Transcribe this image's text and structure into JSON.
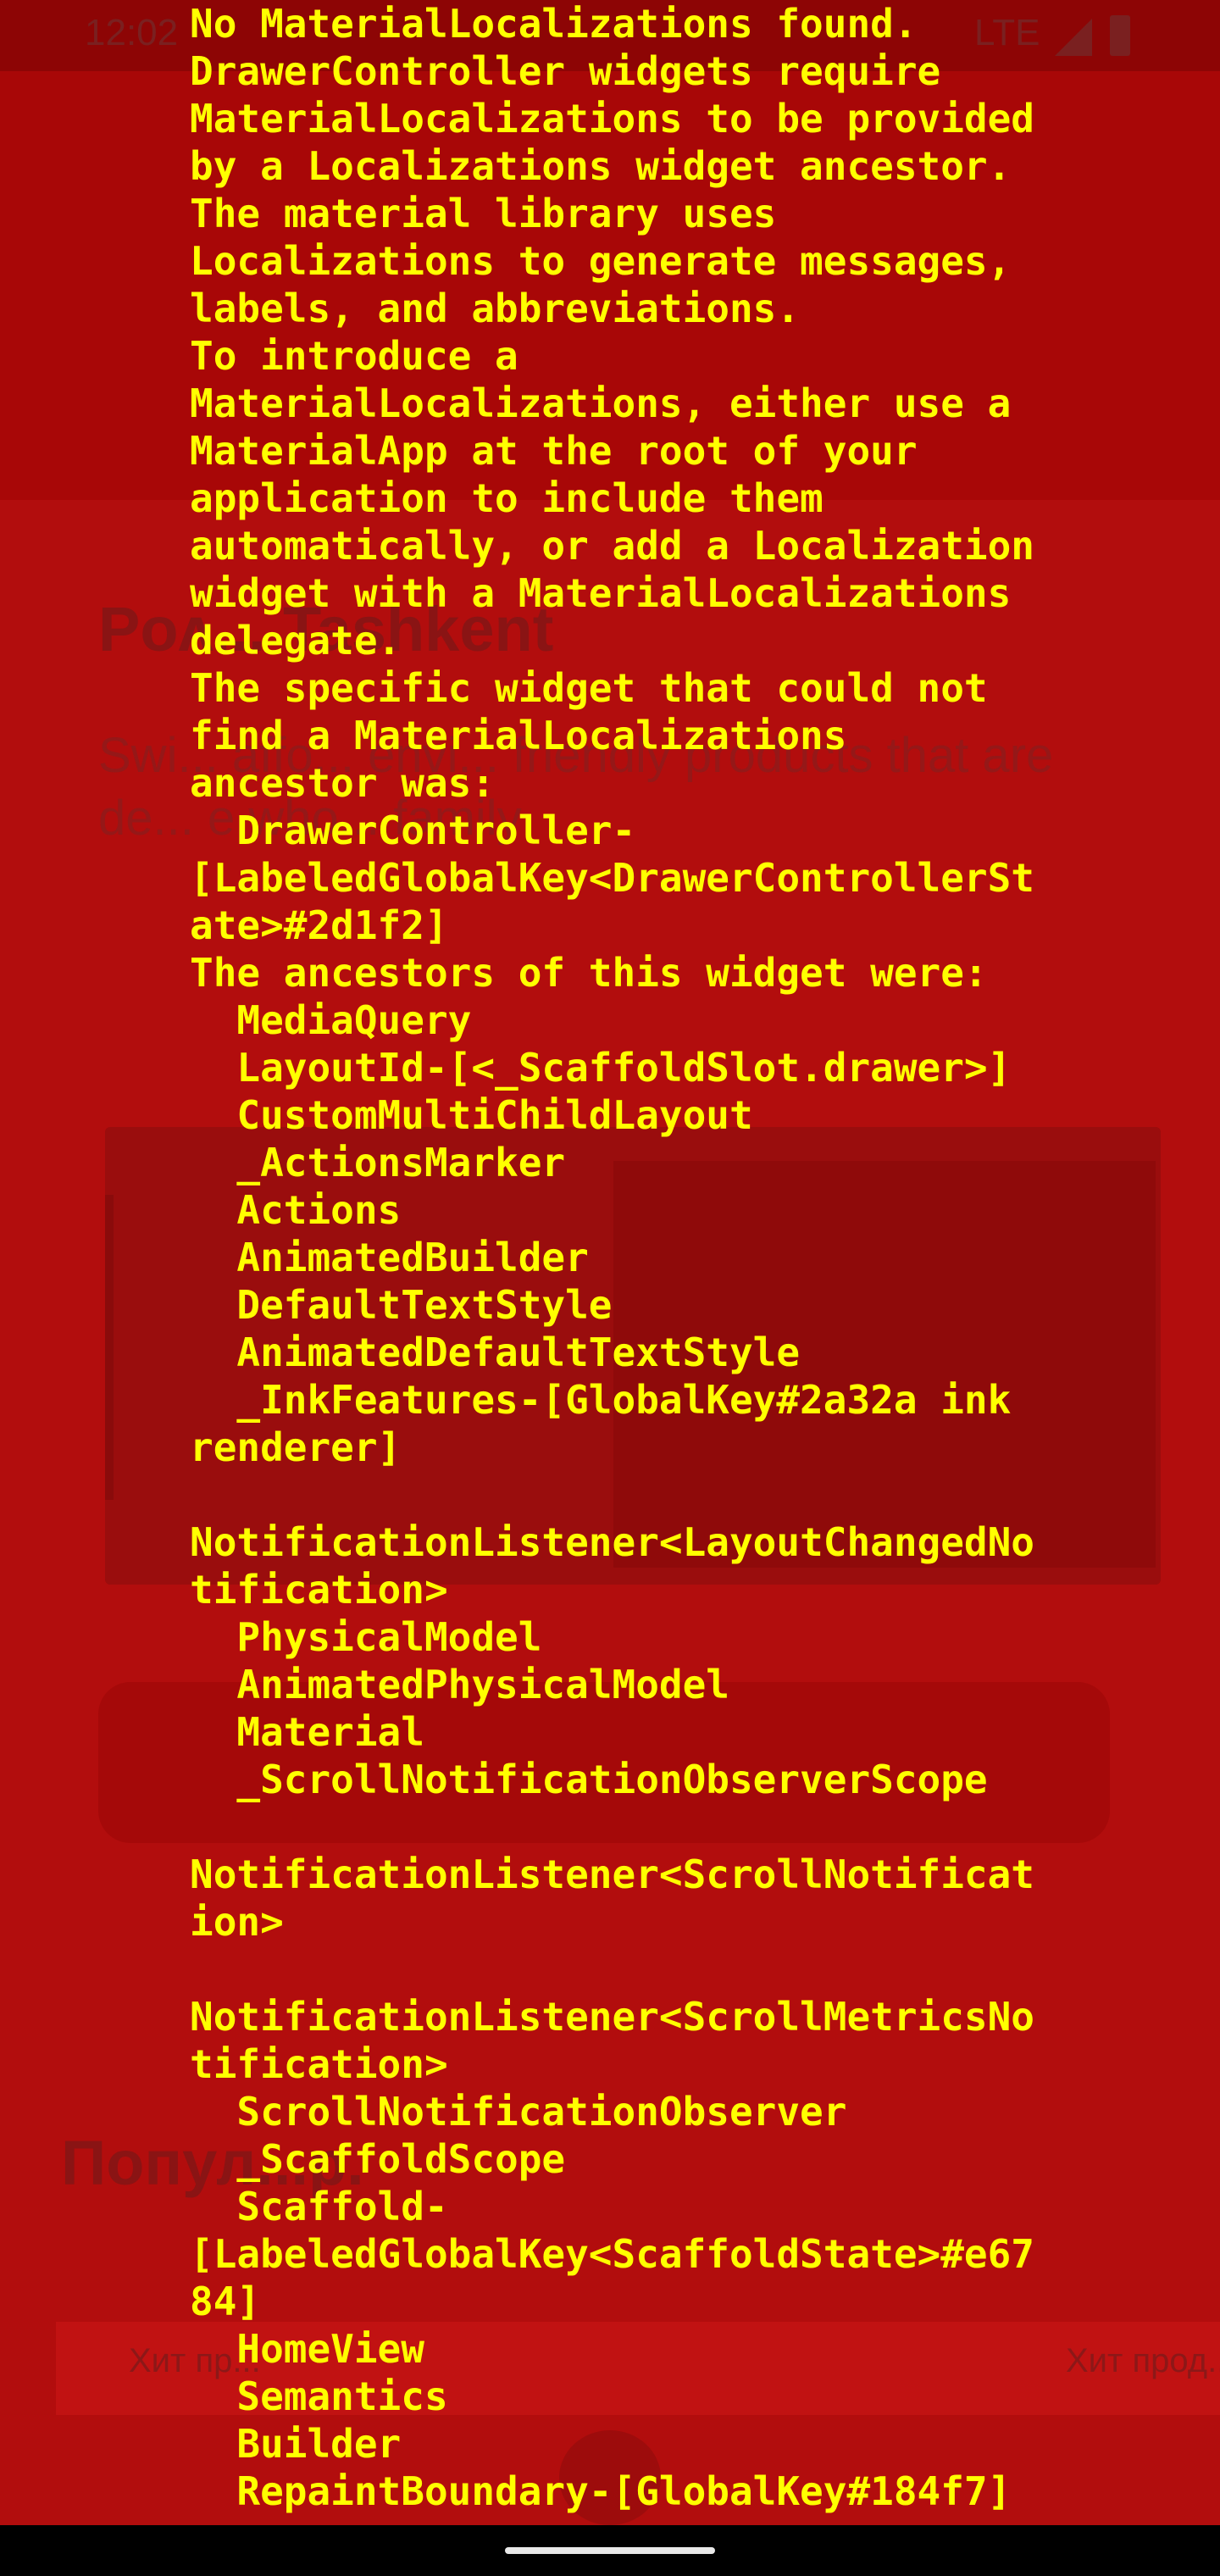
{
  "status_bar": {
    "time": "12:02",
    "network": "LTE"
  },
  "background_app": {
    "hero_title": "Poᴧ... Tashkent",
    "hero_description": "Swi... affo... envi... friendly products that are de... e who... family",
    "popular_title": "Попул...р.",
    "product_badges": [
      "Хит пр...",
      "Хит прод..."
    ]
  },
  "error": {
    "lines": [
      "No MaterialLocalizations found.",
      "DrawerController widgets require MaterialLocalizations to be provided by a Localizations widget ancestor.",
      "The material library uses Localizations to generate messages, labels, and abbreviations.",
      "To introduce a MaterialLocalizations, either use a MaterialApp at the root of your application to include them automatically, or add a Localization widget with a MaterialLocalizations delegate.",
      "The specific widget that could not find a MaterialLocalizations ancestor was:",
      "  DrawerController-[LabeledGlobalKey<DrawerControllerState>#2d1f2]",
      "The ancestors of this widget were:",
      "  MediaQuery",
      "  LayoutId-[<_ScaffoldSlot.drawer>]",
      "  CustomMultiChildLayout",
      "  _ActionsMarker",
      "  Actions",
      "  AnimatedBuilder",
      "  DefaultTextStyle",
      "  AnimatedDefaultTextStyle",
      "  _InkFeatures-[GlobalKey#2a32a ink renderer]",
      "  NotificationListener<LayoutChangedNotification>",
      "  PhysicalModel",
      "  AnimatedPhysicalModel",
      "  Material",
      "  _ScrollNotificationObserverScope",
      "  NotificationListener<ScrollNotification>",
      "  NotificationListener<ScrollMetricsNotification>",
      "  ScrollNotificationObserver",
      "  _ScaffoldScope",
      "  Scaffold-[LabeledGlobalKey<ScaffoldState>#e6784]",
      "  HomeView",
      "  Semantics",
      "  Builder",
      "  RepaintBoundary-[GlobalKey#184f7]"
    ]
  }
}
